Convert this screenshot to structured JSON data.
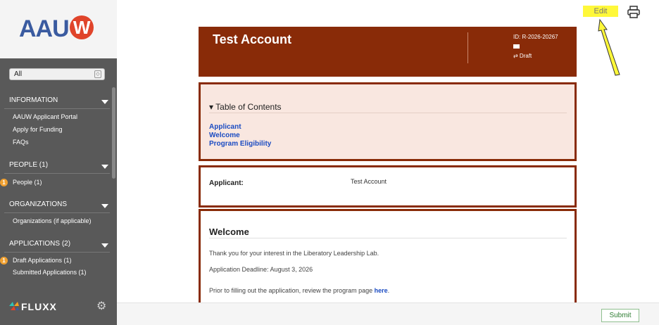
{
  "sidebar": {
    "logo_text": "AAU",
    "logo_mark": "W",
    "filter_value": "All",
    "sections": {
      "information": {
        "label": "INFORMATION",
        "items": [
          "AAUW Applicant Portal",
          "Apply for Funding",
          "FAQs"
        ]
      },
      "people": {
        "label": "PEOPLE (1)",
        "items": [
          "People  (1)"
        ],
        "badge": "1"
      },
      "organizations": {
        "label": "ORGANIZATIONS",
        "items": [
          "Organizations (if applicable)"
        ]
      },
      "applications": {
        "label": "APPLICATIONS (2)",
        "items": [
          "Draft Applications  (1)",
          "Submitted Applications  (1)"
        ],
        "badge": "1"
      }
    },
    "footer_brand": "FLUXX",
    "settings_icon": "gear-icon"
  },
  "toolbar": {
    "edit_label": "Edit",
    "print_icon": "printer-icon"
  },
  "record": {
    "title": "Test Account",
    "id": "ID: R-2026-20267",
    "status": "⇄ Draft"
  },
  "toc": {
    "title": "▾ Table of Contents",
    "links": [
      "Applicant",
      "Welcome",
      "Program Eligibility"
    ]
  },
  "applicant": {
    "label": "Applicant:",
    "value": "Test Account"
  },
  "welcome": {
    "title": "Welcome",
    "p1": "Thank you for your interest in the Liberatory Leadership Lab.",
    "p2": "Application Deadline: August 3, 2026",
    "p3_prefix": "Prior to filling out the application, review the program page ",
    "p3_link": "here",
    "p3_suffix": "."
  },
  "footer": {
    "submit_label": "Submit"
  },
  "colors": {
    "brand": "#892b08",
    "highlight": "#fff83a",
    "link": "#1a4bc2"
  }
}
